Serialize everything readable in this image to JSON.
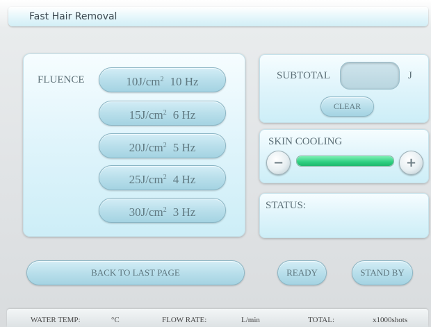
{
  "app": {
    "title": "Fast Hair Removal"
  },
  "fluence": {
    "label": "FLUENCE",
    "options": [
      {
        "energy": "10",
        "unit": "J/cm",
        "exp": "2",
        "freq": "10 Hz"
      },
      {
        "energy": "15",
        "unit": "J/cm",
        "exp": "2",
        "freq": "6 Hz"
      },
      {
        "energy": "20",
        "unit": "J/cm",
        "exp": "2",
        "freq": "5 Hz"
      },
      {
        "energy": "25",
        "unit": "J/cm",
        "exp": "2",
        "freq": "4 Hz"
      },
      {
        "energy": "30",
        "unit": "J/cm",
        "exp": "2",
        "freq": "3 Hz"
      }
    ]
  },
  "subtotal": {
    "label": "SUBTOTAL",
    "value": "",
    "unit": "J",
    "clear_label": "CLEAR"
  },
  "skin_cooling": {
    "label": "SKIN COOLING",
    "minus": "−",
    "plus": "+",
    "level": 1.0,
    "bar_color": "#2ecf80"
  },
  "status": {
    "label": "STATUS:",
    "value": ""
  },
  "actions": {
    "back_label": "BACK TO LAST PAGE",
    "ready_label": "READY",
    "standby_label": "STAND BY"
  },
  "footer": {
    "water_temp_label": "WATER TEMP:",
    "water_temp_unit": "°C",
    "flow_rate_label": "FLOW RATE:",
    "flow_rate_unit": "L/min",
    "total_label": "TOTAL:",
    "total_unit": "x1000shots"
  }
}
